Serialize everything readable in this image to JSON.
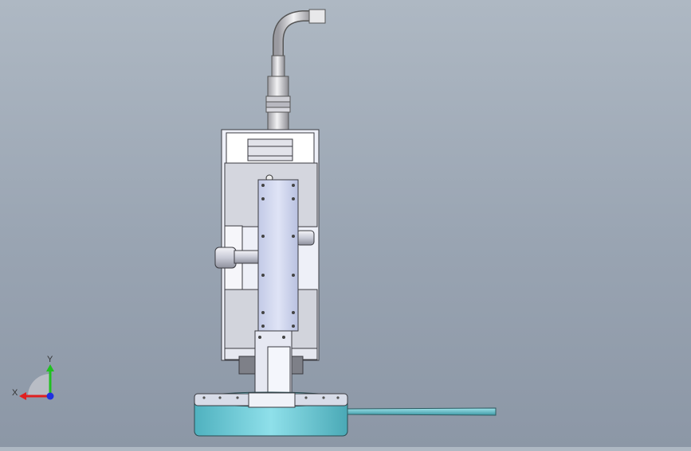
{
  "viewport": {
    "background_top": "#aeb8c3",
    "background_bottom": "#8c97a6"
  },
  "triad": {
    "x_label": "X",
    "y_label": "Y",
    "x_color": "#e02020",
    "y_color": "#20c020",
    "z_color": "#2030e0"
  },
  "model": {
    "body_color": "#e4e6f4",
    "plate_color": "#c6cde8",
    "base_color": "#6dcad6",
    "cable_color": "#cfcfd3",
    "rod_color": "#6bbfc8"
  }
}
